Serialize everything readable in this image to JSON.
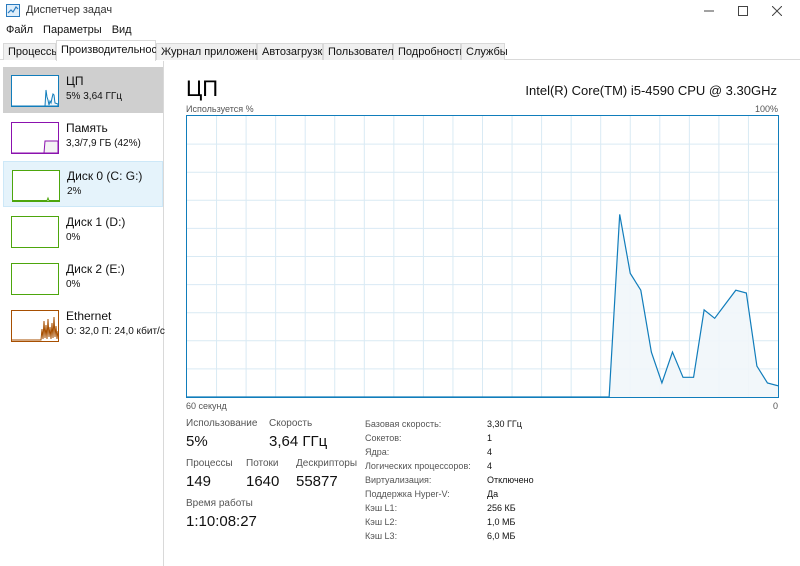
{
  "window": {
    "title": "Диспетчер задач",
    "icon": "task-manager-icon"
  },
  "menu": [
    "Файл",
    "Параметры",
    "Вид"
  ],
  "tabs": [
    "Процессы",
    "Производительность",
    "Журнал приложений",
    "Автозагрузка",
    "Пользователи",
    "Подробности",
    "Службы"
  ],
  "active_tab": "Производительность",
  "sidebar": {
    "items": [
      {
        "name": "ЦП",
        "sub": "5% 3,64 ГГц",
        "color": "#117dbb",
        "active": true
      },
      {
        "name": "Память",
        "sub": "3,3/7,9 ГБ (42%)",
        "color": "#8b12ae"
      },
      {
        "name": "Диск 0 (C: G:)",
        "sub": "2%",
        "color": "#4da60c",
        "hover": true
      },
      {
        "name": "Диск 1 (D:)",
        "sub": "0%",
        "color": "#4da60c"
      },
      {
        "name": "Диск 2 (E:)",
        "sub": "0%",
        "color": "#4da60c"
      },
      {
        "name": "Ethernet",
        "sub": "О: 32,0 П: 24,0 кбит/с",
        "color": "#a74f01"
      }
    ]
  },
  "cpu": {
    "title": "ЦП",
    "model": "Intel(R) Core(TM) i5-4590 CPU @ 3.30GHz",
    "graph_label_top_left": "Используется %",
    "graph_label_top_right": "100%",
    "graph_label_bottom_left": "60 секунд",
    "graph_label_bottom_right": "0",
    "line_color": "#117dbb",
    "usage_history_percent": [
      0,
      0,
      0,
      0,
      0,
      0,
      0,
      0,
      0,
      0,
      0,
      0,
      0,
      0,
      0,
      0,
      0,
      0,
      0,
      0,
      0,
      0,
      0,
      0,
      0,
      0,
      0,
      0,
      0,
      0,
      0,
      0,
      0,
      0,
      0,
      0,
      0,
      0,
      0,
      0,
      0,
      65,
      44,
      38,
      16,
      5,
      16,
      7,
      7,
      31,
      28,
      33,
      38,
      37,
      11,
      5,
      4
    ]
  },
  "stats": {
    "usage_label": "Использование",
    "usage_value": "5%",
    "speed_label": "Скорость",
    "speed_value": "3,64 ГГц",
    "processes_label": "Процессы",
    "processes_value": "149",
    "threads_label": "Потоки",
    "threads_value": "1640",
    "handles_label": "Дескрипторы",
    "handles_value": "55877",
    "uptime_label": "Время работы",
    "uptime_value": "1:10:08:27"
  },
  "properties": [
    {
      "label": "Базовая скорость:",
      "value": "3,30 ГГц"
    },
    {
      "label": "Сокетов:",
      "value": "1"
    },
    {
      "label": "Ядра:",
      "value": "4"
    },
    {
      "label": "Логических процессоров:",
      "value": "4"
    },
    {
      "label": "Виртуализация:",
      "value": "Отключено"
    },
    {
      "label": "Поддержка Hyper-V:",
      "value": "Да"
    },
    {
      "label": "Кэш L1:",
      "value": "256 КБ"
    },
    {
      "label": "Кэш L2:",
      "value": "1,0 МБ"
    },
    {
      "label": "Кэш L3:",
      "value": "6,0 МБ"
    }
  ]
}
